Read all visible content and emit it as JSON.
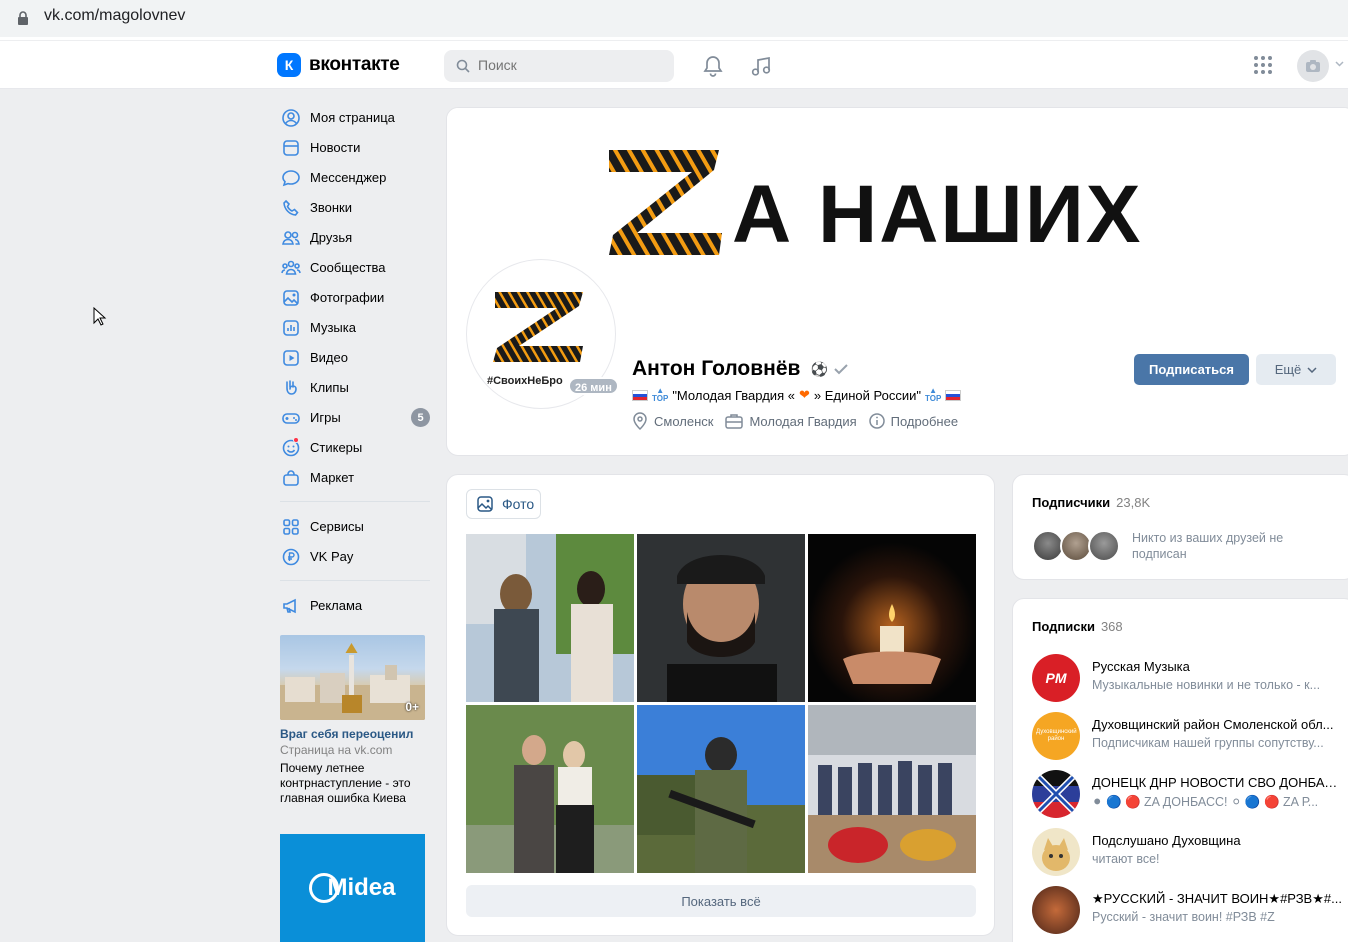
{
  "browser": {
    "url": "vk.com/magolovnev"
  },
  "header": {
    "logo_letter": "К",
    "logo_text": "вконтакте",
    "search_placeholder": "Поиск"
  },
  "nav": {
    "items": [
      {
        "label": "Моя страница",
        "icon": "user-circle-icon"
      },
      {
        "label": "Новости",
        "icon": "news-icon"
      },
      {
        "label": "Мессенджер",
        "icon": "message-icon"
      },
      {
        "label": "Звонки",
        "icon": "phone-icon"
      },
      {
        "label": "Друзья",
        "icon": "friends-icon"
      },
      {
        "label": "Сообщества",
        "icon": "groups-icon"
      },
      {
        "label": "Фотографии",
        "icon": "photo-icon"
      },
      {
        "label": "Музыка",
        "icon": "music-icon"
      },
      {
        "label": "Видео",
        "icon": "video-icon"
      },
      {
        "label": "Клипы",
        "icon": "clips-icon"
      },
      {
        "label": "Игры",
        "icon": "gamepad-icon",
        "count": "5"
      },
      {
        "label": "Стикеры",
        "icon": "sticker-icon"
      },
      {
        "label": "Маркет",
        "icon": "market-bag-icon"
      }
    ],
    "services": [
      {
        "label": "Сервисы",
        "icon": "services-grid-icon"
      },
      {
        "label": "VK Pay",
        "icon": "vkpay-icon"
      }
    ],
    "ads_label": "Реклама"
  },
  "ads": {
    "ad1": {
      "age": "0+",
      "title": "Враг себя переоценил",
      "domain": "Страница на vk.com",
      "text": "Почему летнее контрнаступление - это главная ошибка Киева"
    },
    "ad2": {
      "brand": "Midea"
    }
  },
  "profile": {
    "cover_text": "А НАШИХ",
    "avatar_tag": "#СвоихНеБро",
    "online": "26 мин",
    "name": "Антон Головнёв",
    "status": "\"Молодая Гвардия « ",
    "status_end": " » Единой России\"",
    "top_label": "TOP",
    "city": "Смоленск",
    "work": "Молодая Гвардия",
    "more_info": "Подробнее",
    "subscribe_label": "Подписаться",
    "more_label": "Ещё"
  },
  "photos": {
    "tab_label": "Фото",
    "show_all": "Показать всё"
  },
  "subscribers": {
    "title": "Подписчики",
    "count": "23,8K",
    "text": "Никто из ваших друзей не подписан"
  },
  "following": {
    "title": "Подписки",
    "count": "368",
    "items": [
      {
        "name": "Русская Музыка",
        "desc": "Музыкальные новинки и не только - к...",
        "color": "#d91f26",
        "avatar_text": "РМ"
      },
      {
        "name": "Духовщинский район Смоленской обл...",
        "desc": "Подписчикам нашей группы сопутству...",
        "color": "#f5a623",
        "avatar_text": "Духовщинский район"
      },
      {
        "name": "ДОНЕЦК ДНР НОВОСТИ СВО ДОНБАС...",
        "desc": "⚫ 🔵 🔴 ZA ДОНБАСС! ⚪ 🔵 🔴 ZA Р...",
        "color": "#2c3e7a",
        "avatar_text": ""
      },
      {
        "name": "Подслушано Духовщина",
        "desc": "читают все!",
        "color": "#f0e6c8",
        "avatar_text": ""
      },
      {
        "name": "★РУССКИЙ - ЗНАЧИТ ВОИН★#РЗВ★#...",
        "desc": "Русский - значит воин! #РЗВ #Z",
        "color": "#8a4a2a",
        "avatar_text": ""
      }
    ]
  },
  "colors": {
    "accent": "#4a76a8",
    "link": "#2a5885",
    "vk_blue": "#0077ff"
  }
}
